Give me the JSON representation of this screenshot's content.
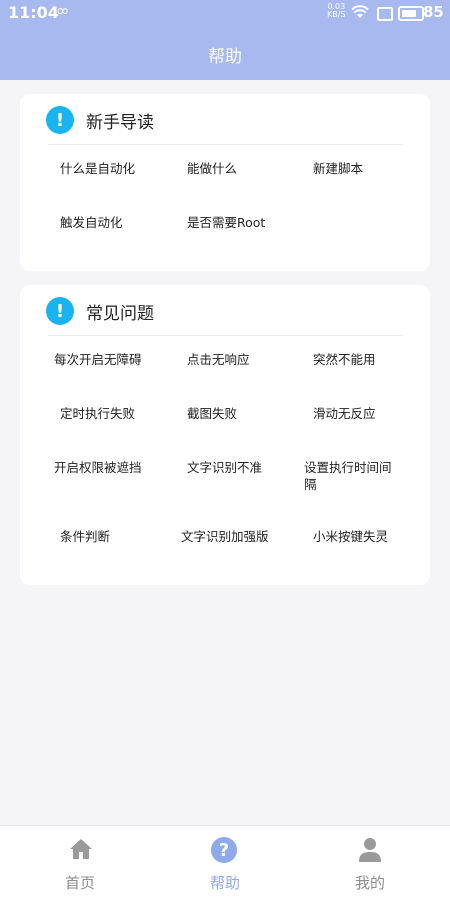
{
  "status_bar": {
    "time": "11:04",
    "loop_glyph": "∞",
    "net_speed_value": "0.03",
    "net_speed_unit": "KB/S",
    "battery_level": "85"
  },
  "header": {
    "title": "帮助"
  },
  "guide": {
    "title": "新手导读",
    "items": [
      "什么是自动化",
      "能做什么",
      "新建脚本",
      "触发自动化",
      "是否需要Root"
    ]
  },
  "faq": {
    "title": "常见问题",
    "items": [
      "每次开启无障碍",
      "点击无响应",
      "突然不能用",
      "定时执行失败",
      "截图失败",
      "滑动无反应",
      "开启权限被遮挡",
      "文字识别不准",
      "设置执行时间间隔",
      "条件判断",
      "文字识别加强版",
      "小米按键失灵"
    ]
  },
  "bottom_nav": {
    "items": [
      {
        "label": "首页",
        "icon": "home-icon"
      },
      {
        "label": "帮助",
        "icon": "help-icon"
      },
      {
        "label": "我的",
        "icon": "person-icon"
      }
    ],
    "active_color": "#8faae8",
    "inactive_color": "#8d8d8d"
  },
  "colors": {
    "header_bg": "#a7b9ee",
    "card_icon": "#19b3f0",
    "page_bg": "#f5f5f7"
  }
}
